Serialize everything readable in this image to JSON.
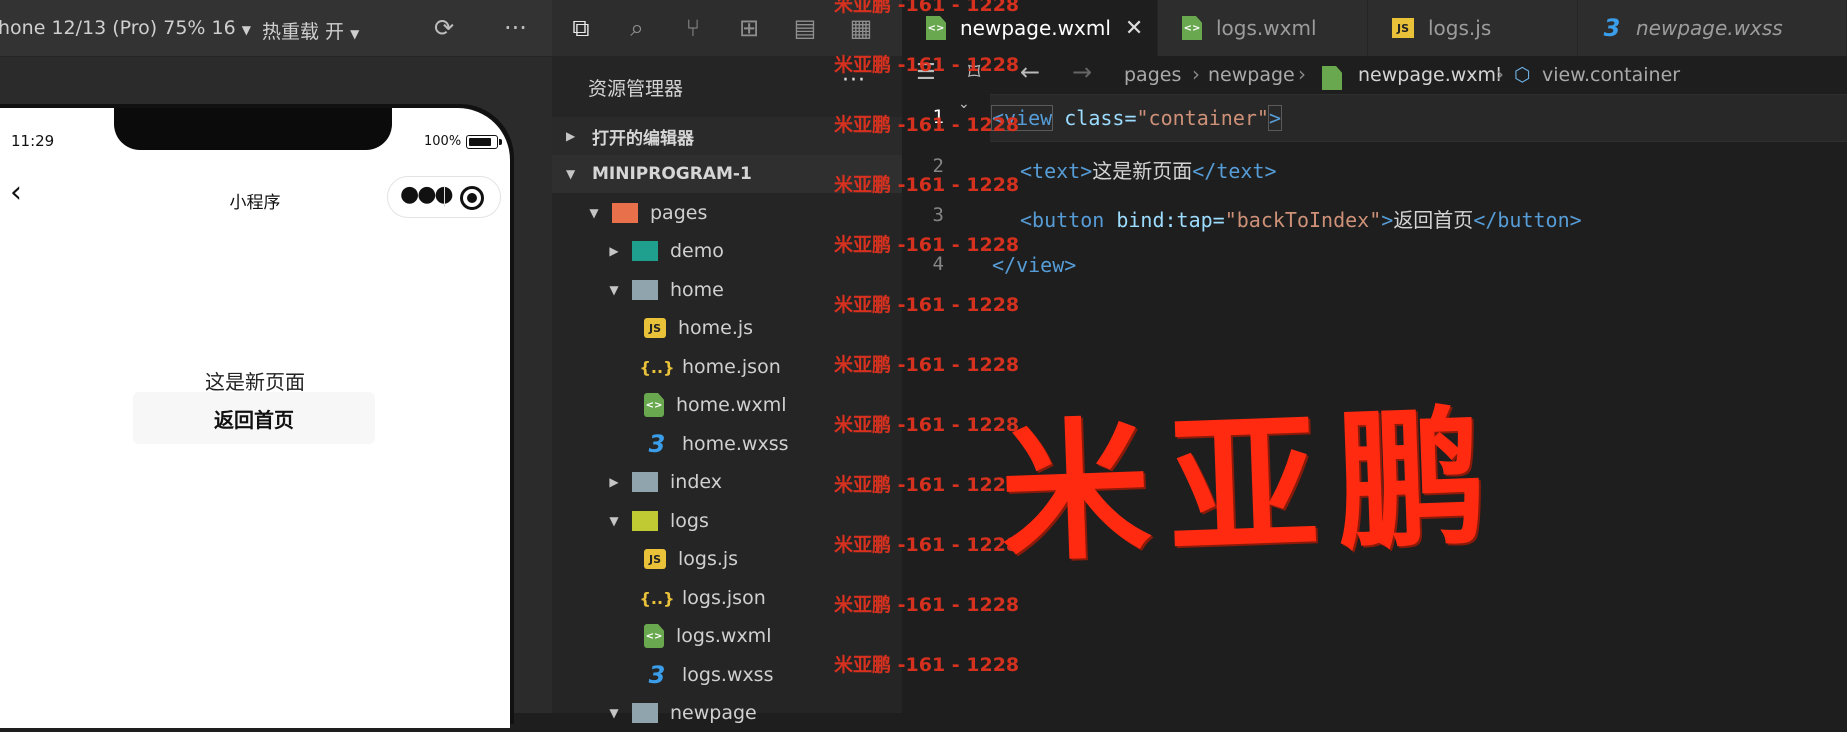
{
  "simulator": {
    "device_label": "hone 12/13 (Pro) 75% 16",
    "hot_reload_label": "热重载 开",
    "status_time": "11:29",
    "battery_pct": "100%",
    "nav_title": "小程序",
    "page_text": "这是新页面",
    "page_button": "返回首页"
  },
  "explorer": {
    "title": "资源管理器",
    "section_open_editors": "打开的编辑器",
    "section_project": "MINIPROGRAM-1",
    "tree": [
      {
        "label": "pages",
        "type": "folder-open",
        "level": 1,
        "color": "#e8704a"
      },
      {
        "label": "demo",
        "type": "folder",
        "level": 2,
        "color": "#1fa08f"
      },
      {
        "label": "home",
        "type": "folder-open",
        "level": 2,
        "color": "#90a4ae"
      },
      {
        "label": "home.js",
        "type": "js",
        "level": 3
      },
      {
        "label": "home.json",
        "type": "json",
        "level": 3
      },
      {
        "label": "home.wxml",
        "type": "wxml",
        "level": 3
      },
      {
        "label": "home.wxss",
        "type": "wxss",
        "level": 3
      },
      {
        "label": "index",
        "type": "folder",
        "level": 2,
        "color": "#90a4ae"
      },
      {
        "label": "logs",
        "type": "folder-open",
        "level": 2,
        "color": "#c0ca33"
      },
      {
        "label": "logs.js",
        "type": "js",
        "level": 3
      },
      {
        "label": "logs.json",
        "type": "json",
        "level": 3
      },
      {
        "label": "logs.wxml",
        "type": "wxml",
        "level": 3
      },
      {
        "label": "logs.wxss",
        "type": "wxss",
        "level": 3
      },
      {
        "label": "newpage",
        "type": "folder-open",
        "level": 2,
        "color": "#90a4ae"
      }
    ]
  },
  "editor": {
    "tabs": [
      {
        "label": "newpage.wxml",
        "type": "wxml",
        "active": true
      },
      {
        "label": "logs.wxml",
        "type": "wxml",
        "active": false
      },
      {
        "label": "logs.js",
        "type": "js",
        "active": false
      },
      {
        "label": "newpage.wxss",
        "type": "wxss",
        "active": false
      }
    ],
    "breadcrumbs": [
      "pages",
      "newpage",
      "newpage.wxml",
      "view.container"
    ],
    "line_numbers": [
      "1",
      "2",
      "3",
      "4"
    ],
    "code": {
      "l1_open": "<view",
      "l1_attr": " class=",
      "l1_str": "\"container\"",
      "l1_close": ">",
      "l2_open": "<text>",
      "l2_text": "这是新页面",
      "l2_close": "</text>",
      "l3_open": "<button",
      "l3_attr": " bind:tap=",
      "l3_str": "\"backToIndex\"",
      "l3_gt": ">",
      "l3_text": "返回首页",
      "l3_close": "</button>",
      "l4": "</view>"
    }
  },
  "watermark": {
    "line": "米亚鹏 -161 - 1228",
    "big": "米亚鹏"
  },
  "colors": {
    "tag": "#569cd6",
    "string": "#ce9178",
    "watermark": "#e0321f"
  }
}
